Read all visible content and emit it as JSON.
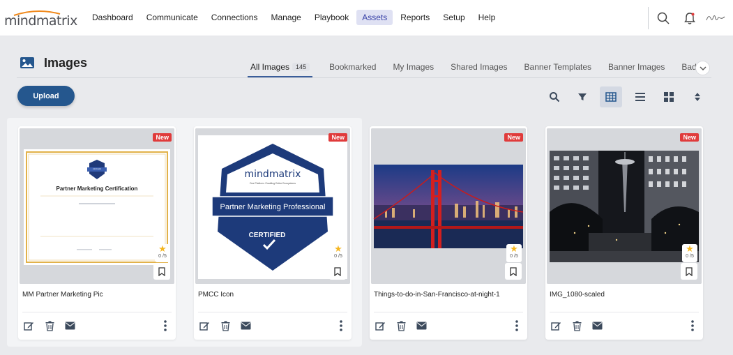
{
  "brand": {
    "name": "mindmatrix"
  },
  "nav": {
    "items": [
      {
        "label": "Dashboard",
        "active": false
      },
      {
        "label": "Communicate",
        "active": false
      },
      {
        "label": "Connections",
        "active": false
      },
      {
        "label": "Manage",
        "active": false
      },
      {
        "label": "Playbook",
        "active": false
      },
      {
        "label": "Assets",
        "active": true
      },
      {
        "label": "Reports",
        "active": false
      },
      {
        "label": "Setup",
        "active": false
      },
      {
        "label": "Help",
        "active": false
      }
    ],
    "icons": [
      "search-icon",
      "bell-icon",
      "signature-icon"
    ]
  },
  "page": {
    "title": "Images",
    "upload_label": "Upload",
    "tabs": [
      {
        "label": "All Images",
        "count": "145",
        "active": true
      },
      {
        "label": "Bookmarked"
      },
      {
        "label": "My Images"
      },
      {
        "label": "Shared Images"
      },
      {
        "label": "Banner Templates"
      },
      {
        "label": "Banner Images"
      },
      {
        "label": "Badges"
      }
    ],
    "tools": [
      "search-icon",
      "filter-icon",
      "grid-view-icon",
      "list-view-icon",
      "tile-view-icon",
      "sort-icon"
    ]
  },
  "cards": [
    {
      "name": "MM Partner Marketing Pic",
      "badge": "New",
      "rating": "0 /5",
      "thumb": {
        "kind": "certificate",
        "title": "Partner Marketing Certification",
        "seal_text": "mindmatrix"
      }
    },
    {
      "name": "PMCC Icon",
      "badge": "New",
      "rating": "0 /5",
      "thumb": {
        "kind": "badge",
        "brand": "mindmatrix",
        "tagline": "One Platform. Enabling Entire Ecosystems",
        "title": "Partner Marketing Professional",
        "status": "CERTIFIED"
      }
    },
    {
      "name": "Things-to-do-in-San-Francisco-at-night-1",
      "badge": "New",
      "rating": "0 /5",
      "thumb": {
        "kind": "photo-bridge"
      }
    },
    {
      "name": "IMG_1080-scaled",
      "badge": "New",
      "rating": "0 /5",
      "thumb": {
        "kind": "photo-needle"
      }
    }
  ],
  "colors": {
    "accent": "#25578e",
    "nav_active_bg": "#dfe1f3",
    "badge_new": "#e03b3b",
    "star": "#f5b620"
  }
}
